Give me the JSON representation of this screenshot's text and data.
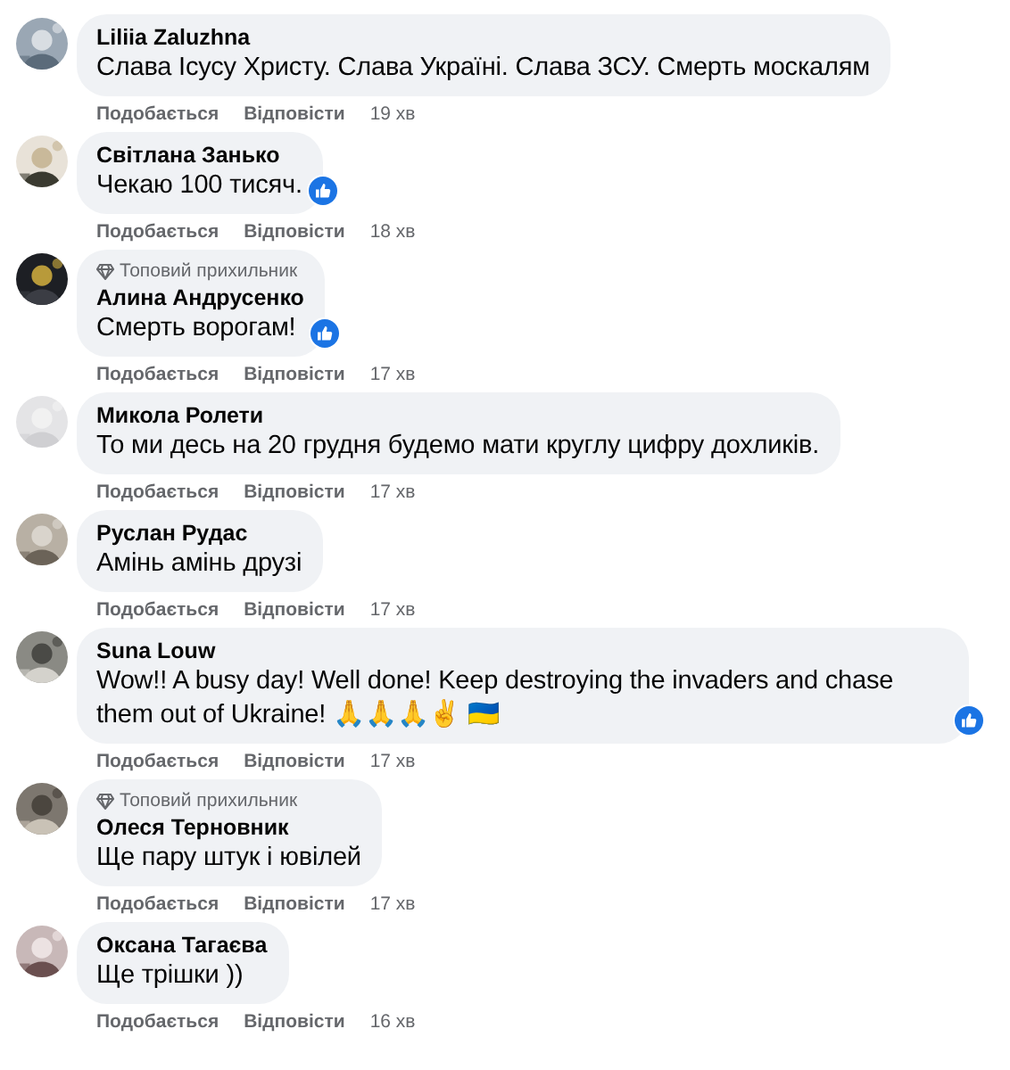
{
  "comments": [
    {
      "author": "Liliia Zaluzhna",
      "text": "Слава Ісусу Христу. Слава Україні. Слава ЗСУ. Смерть москалям",
      "like_reaction": false,
      "actions": [
        "Подобається",
        "Відповісти"
      ],
      "time": "19 хв"
    },
    {
      "author": "Світлана Занько",
      "text": "Чекаю 100 тисяч.",
      "like_reaction": true,
      "actions": [
        "Подобається",
        "Відповісти"
      ],
      "time": "18 хв"
    },
    {
      "badge": "Топовий прихильник",
      "author": "Алина Андрусенко",
      "text": "Смерть ворогам!",
      "like_reaction": true,
      "actions": [
        "Подобається",
        "Відповісти"
      ],
      "time": "17 хв"
    },
    {
      "author": "Микола Ролети",
      "text": "То ми десь на 20 грудня будемо мати круглу цифру дохликів.",
      "like_reaction": false,
      "actions": [
        "Подобається",
        "Відповісти"
      ],
      "time": "17 хв"
    },
    {
      "author": "Руслан Рудас",
      "text": "Амінь амінь друзі",
      "like_reaction": false,
      "actions": [
        "Подобається",
        "Відповісти"
      ],
      "time": "17 хв"
    },
    {
      "author": "Suna Louw",
      "text": "Wow!! A busy day! Well done! Keep destroying the invaders and chase them out of Ukraine! 🙏🙏🙏✌ 🇺🇦",
      "like_reaction": true,
      "actions": [
        "Подобається",
        "Відповісти"
      ],
      "time": "17 хв"
    },
    {
      "badge": "Топовий прихильник",
      "author": "Олеся Терновник",
      "text": "Ще пару штук і ювілей",
      "like_reaction": false,
      "actions": [
        "Подобається",
        "Відповісти"
      ],
      "time": "17 хв"
    },
    {
      "author": "Оксана Тагаєва",
      "text": "Ще трішки ))",
      "like_reaction": false,
      "actions": [
        "Подобається",
        "Відповісти"
      ],
      "time": "16 хв"
    }
  ]
}
